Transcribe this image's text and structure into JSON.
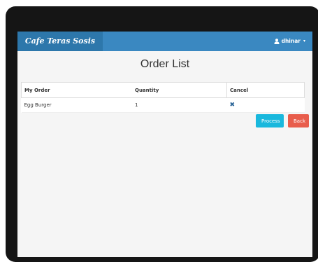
{
  "navbar": {
    "brand": "Cafe Teras Sosis",
    "user": "dhinar",
    "user_icon": "user-icon",
    "caret_icon": "caret-down-icon"
  },
  "page": {
    "title": "Order List"
  },
  "table": {
    "columns": [
      "My Order",
      "Quantity",
      "Cancel"
    ],
    "rows": [
      {
        "order": "Egg Burger",
        "quantity": "1",
        "cancel_icon": "remove-icon"
      }
    ]
  },
  "actions": {
    "process_label": "Process",
    "back_label": "Back"
  },
  "colors": {
    "navbar": "#3a88c1",
    "brand_bg": "#2d77ab",
    "process": "#19b8dd",
    "back": "#e85d4c"
  }
}
